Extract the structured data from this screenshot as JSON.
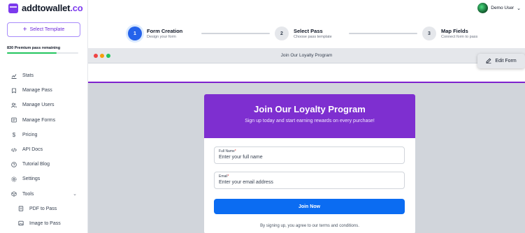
{
  "brand": {
    "name_main": "addtowallet",
    "name_tld": ".co",
    "accent": "#7c3aed"
  },
  "sidebar": {
    "select_template_label": "Select Template",
    "premium_text": "830 Premium pass remaining",
    "premium_fraction": 0.7,
    "items": [
      {
        "label": "Stats",
        "icon": "chart-icon"
      },
      {
        "label": "Manage Pass",
        "icon": "pass-icon"
      },
      {
        "label": "Manage Users",
        "icon": "users-icon"
      },
      {
        "label": "Manage Forms",
        "icon": "forms-icon"
      },
      {
        "label": "Pricing",
        "icon": "dollar-icon"
      },
      {
        "label": "API Docs",
        "icon": "code-icon"
      },
      {
        "label": "Tutorial Blog",
        "icon": "help-icon"
      },
      {
        "label": "Settings",
        "icon": "gear-icon"
      },
      {
        "label": "Tools",
        "icon": "tools-icon"
      },
      {
        "label": "PDF to Pass",
        "icon": "document-icon"
      },
      {
        "label": "Image to Pass",
        "icon": "image-icon"
      }
    ]
  },
  "header": {
    "user_name": "Demo User"
  },
  "stepper": {
    "steps": [
      {
        "number": "1",
        "title": "Form Creation",
        "subtitle": "Design your form",
        "active": true
      },
      {
        "number": "2",
        "title": "Select Pass",
        "subtitle": "Choose pass template",
        "active": false
      },
      {
        "number": "3",
        "title": "Map Fields",
        "subtitle": "Connect form to pass",
        "active": false
      }
    ]
  },
  "preview": {
    "window_title": "Join Our Loyalty Program",
    "edit_form_label": "Edit Form",
    "form": {
      "title": "Join Our Loyalty Program",
      "subtitle": "Sign up today and start earning rewards on every purchase!",
      "header_color": "#7e2fd0",
      "fields": [
        {
          "label": "Full Name",
          "required_mark": "*",
          "placeholder": "Enter your full name"
        },
        {
          "label": "Email",
          "required_mark": "*",
          "placeholder": "Enter your email address"
        }
      ],
      "submit_label": "Join Now",
      "terms": "By signing up, you agree to our terms and conditions."
    }
  }
}
